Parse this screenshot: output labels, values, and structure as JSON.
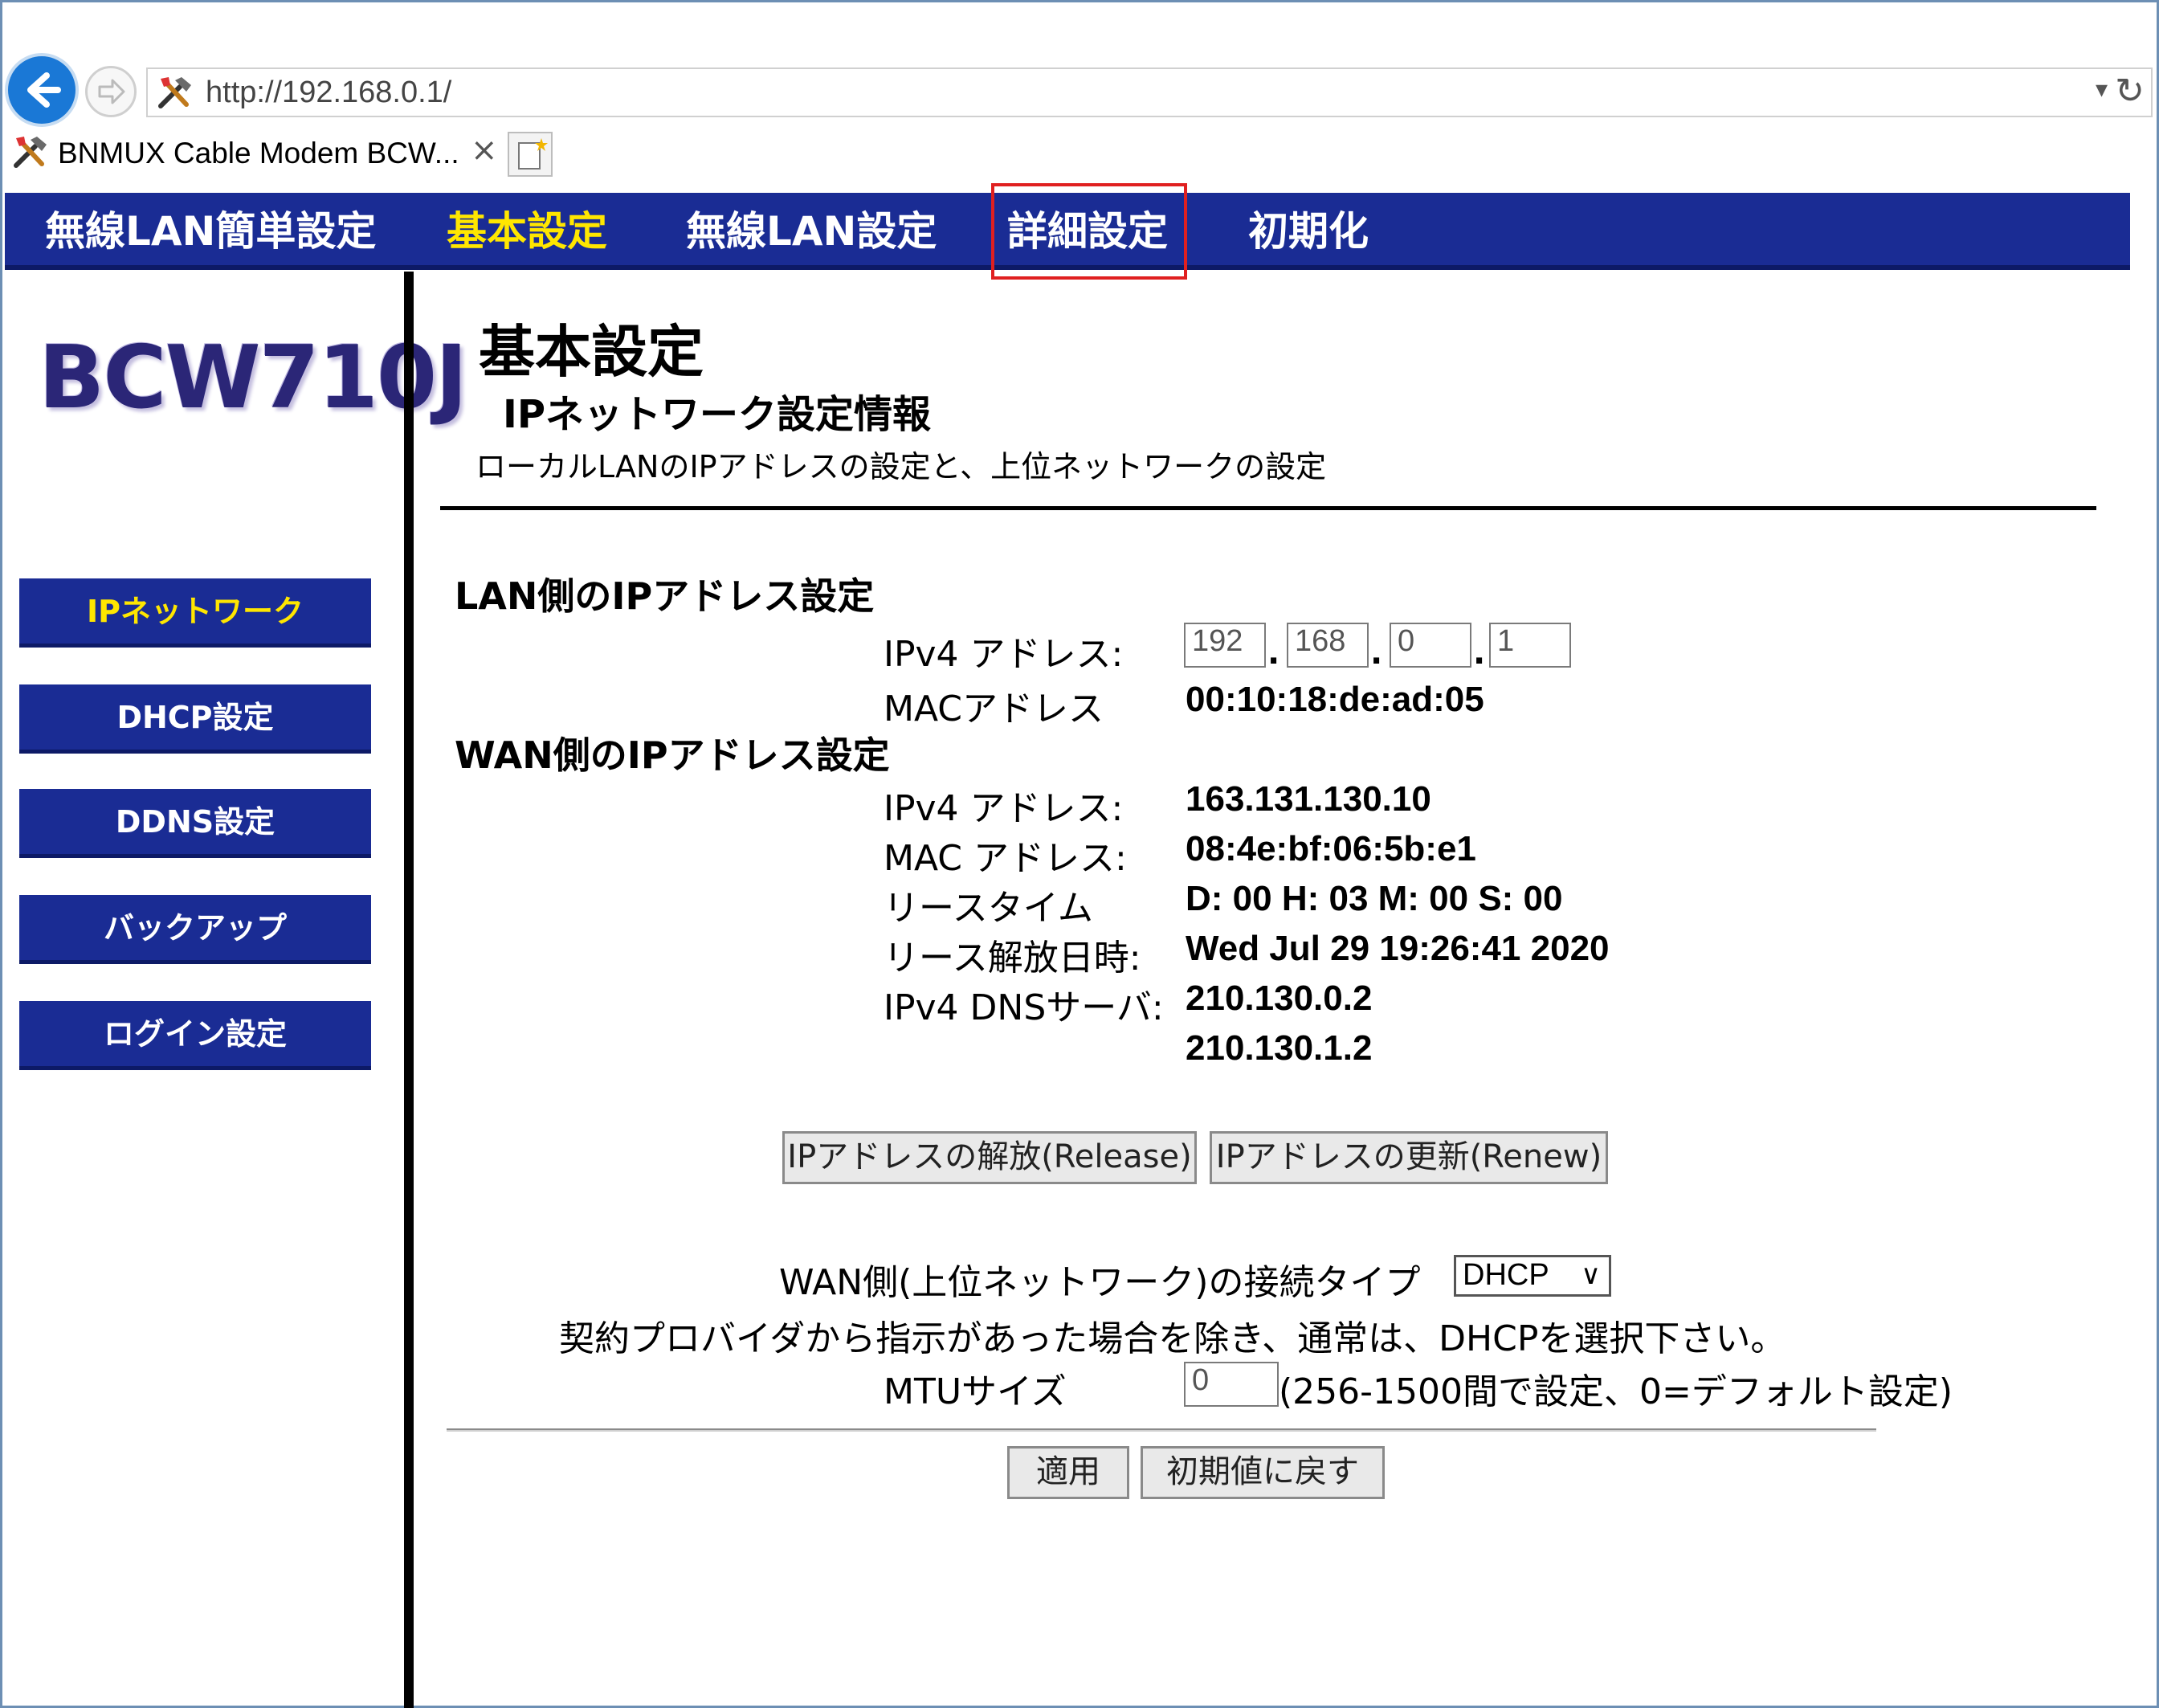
{
  "browser": {
    "url": "http://192.168.0.1/",
    "tab_title": "BNMUX Cable Modem BCW...",
    "tab_close": "×",
    "url_dropdown": "▾",
    "refresh": "↻"
  },
  "topnav": {
    "items": [
      {
        "label": "無線LAN簡単設定"
      },
      {
        "label": "基本設定"
      },
      {
        "label": "無線LAN設定"
      },
      {
        "label": "詳細設定"
      },
      {
        "label": "初期化"
      }
    ],
    "active_index": 1,
    "highlighted_index": 3
  },
  "sidebar": {
    "logo": "BCW710J",
    "items": [
      {
        "label": "IPネットワーク"
      },
      {
        "label": "DHCP設定"
      },
      {
        "label": "DDNS設定"
      },
      {
        "label": "バックアップ"
      },
      {
        "label": "ログイン設定"
      }
    ],
    "active_index": 0
  },
  "main": {
    "page_title": "基本設定",
    "section_title": "IPネットワーク設定情報",
    "section_desc": "ローカルLANのIPアドレスの設定と、上位ネットワークの設定",
    "lan": {
      "title": "LAN側のIPアドレス設定",
      "ipv4_label": "IPv4 アドレス:",
      "ipv4_octets": [
        "192",
        "168",
        "0",
        "1"
      ],
      "mac_label": "MACアドレス",
      "mac_value": "00:10:18:de:ad:05"
    },
    "wan": {
      "title": "WAN側のIPアドレス設定",
      "ipv4_label": "IPv4 アドレス:",
      "ipv4_value": "163.131.130.10",
      "mac_label": "MAC アドレス:",
      "mac_value": "08:4e:bf:06:5b:e1",
      "lease_label": "リースタイム",
      "lease_value": "D: 00 H: 03 M: 00 S: 00",
      "expire_label": "リース解放日時:",
      "expire_value": "Wed Jul 29 19:26:41 2020",
      "dns_label": "IPv4 DNSサーバ:",
      "dns_values": [
        "210.130.0.2",
        "210.130.1.2"
      ]
    },
    "release_button": "IPアドレスの解放(Release)",
    "renew_button": "IPアドレスの更新(Renew)",
    "conn_type_label": "WAN側(上位ネットワーク)の接続タイプ",
    "conn_type_value": "DHCP",
    "conn_type_arrow": "∨",
    "note": "契約プロバイダから指示があった場合を除き、通常は、DHCPを選択下さい。",
    "mtu_label": "MTUサイズ",
    "mtu_value": "0",
    "mtu_hint": "(256-1500間で設定、0=デフォルト設定)",
    "apply_button": "適用",
    "reset_button": "初期値に戻す"
  },
  "colors": {
    "nav_blue": "#1a2c94",
    "active_yellow": "#ffe600",
    "highlight_red": "#e02020"
  }
}
